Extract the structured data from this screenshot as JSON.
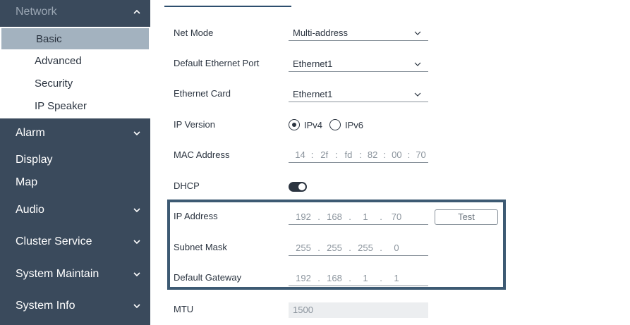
{
  "sidebar": {
    "network": {
      "label": "Network"
    },
    "network_sub": [
      {
        "label": "Basic",
        "active": true
      },
      {
        "label": "Advanced"
      },
      {
        "label": "Security"
      },
      {
        "label": "IP Speaker"
      }
    ],
    "items": [
      {
        "label": "Alarm",
        "expandable": true
      },
      {
        "label": "Display",
        "expandable": false
      },
      {
        "label": "Map",
        "expandable": false
      },
      {
        "label": "Audio",
        "expandable": true
      },
      {
        "label": "Cluster Service",
        "expandable": true
      },
      {
        "label": "System Maintain",
        "expandable": true
      },
      {
        "label": "System Info",
        "expandable": true
      }
    ]
  },
  "form": {
    "net_mode": {
      "label": "Net Mode",
      "value": "Multi-address"
    },
    "default_port": {
      "label": "Default Ethernet Port",
      "value": "Ethernet1"
    },
    "ethernet_card": {
      "label": "Ethernet Card",
      "value": "Ethernet1"
    },
    "ip_version": {
      "label": "IP Version",
      "options": [
        "IPv4",
        "IPv6"
      ],
      "selected": "IPv4"
    },
    "mac": {
      "label": "MAC Address",
      "segments": [
        "14",
        "2f",
        "fd",
        "82",
        "00",
        "70"
      ]
    },
    "dhcp": {
      "label": "DHCP",
      "on": true
    },
    "ip_address": {
      "label": "IP Address",
      "segments": [
        "192",
        "168",
        "1",
        "70"
      ],
      "test_label": "Test"
    },
    "subnet_mask": {
      "label": "Subnet Mask",
      "segments": [
        "255",
        "255",
        "255",
        "0"
      ]
    },
    "gateway": {
      "label": "Default Gateway",
      "segments": [
        "192",
        "168",
        "1",
        "1"
      ]
    },
    "mtu": {
      "label": "MTU",
      "value": "1500"
    }
  },
  "colors": {
    "sidebar_bg": "#3a4a5c",
    "active_item": "#a3b2bf",
    "highlight_border": "#3d5a73"
  }
}
